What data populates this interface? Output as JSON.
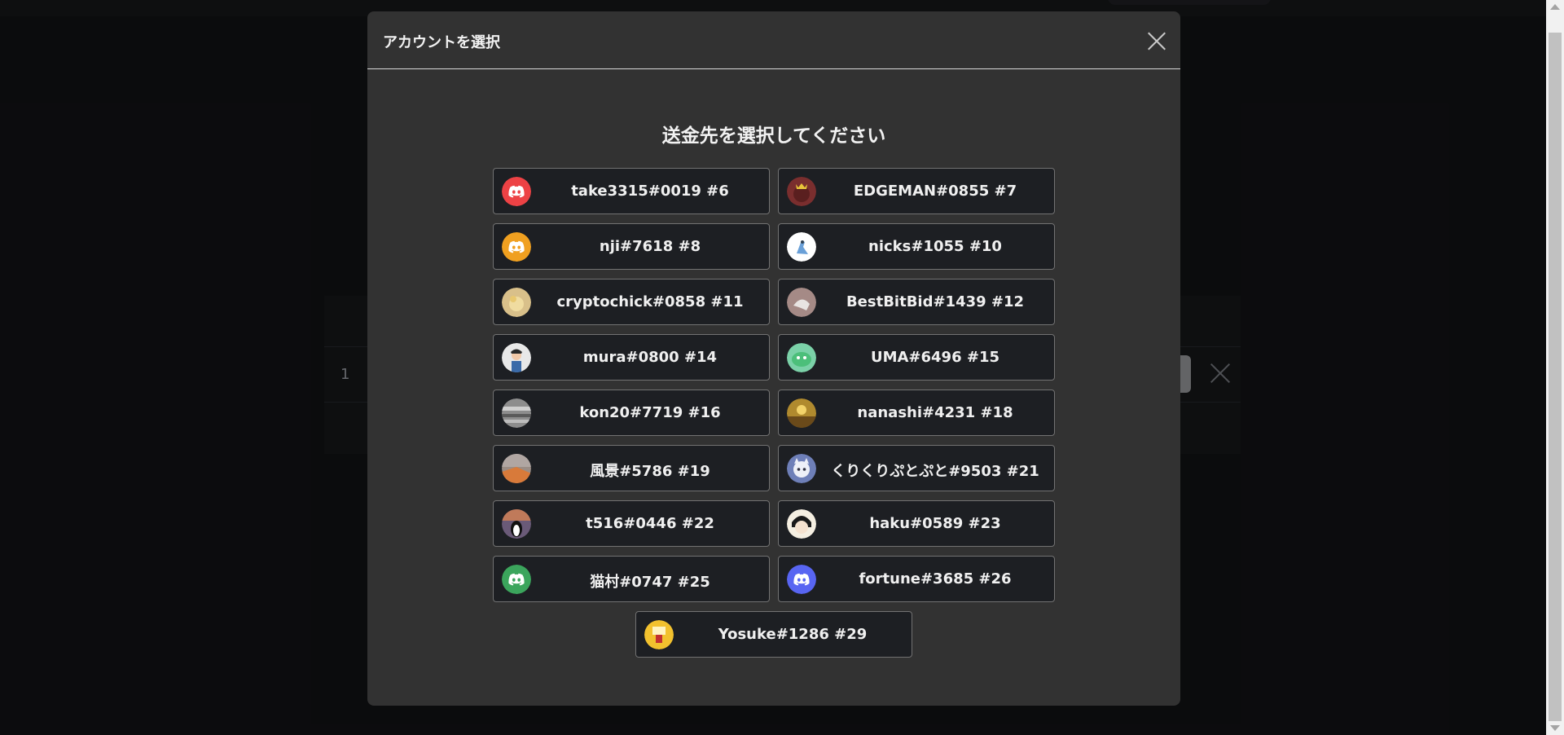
{
  "background": {
    "row_number": "1"
  },
  "modal": {
    "title": "アカウントを選択",
    "heading": "送金先を選択してください"
  },
  "accounts": [
    {
      "name": "take3315#0019 #6",
      "avatar": "discord-icon",
      "color": "#ed4245"
    },
    {
      "name": "EDGEMAN#0855 #7",
      "avatar": "crowned-creature-avatar",
      "color": "#7a2e2e"
    },
    {
      "name": "nji#7618 #8",
      "avatar": "discord-icon",
      "color": "#f0a020"
    },
    {
      "name": "nicks#1055 #10",
      "avatar": "bird-avatar",
      "color": "#ffffff"
    },
    {
      "name": "cryptochick#0858 #11",
      "avatar": "chick-photo-avatar",
      "color": "#d9c08a"
    },
    {
      "name": "BestBitBid#1439 #12",
      "avatar": "bird-photo-avatar",
      "color": "#a58a86"
    },
    {
      "name": "mura#0800 #14",
      "avatar": "person-avatar",
      "color": "#e8e8e8"
    },
    {
      "name": "UMA#6496 #15",
      "avatar": "green-creature-avatar",
      "color": "#7bd1a8"
    },
    {
      "name": "kon20#7719 #16",
      "avatar": "grayscale-photo-avatar",
      "color": "#8d8d8d"
    },
    {
      "name": "nanashi#4231 #18",
      "avatar": "sunset-photo-avatar",
      "color": "#b08a2e"
    },
    {
      "name": "風景#5786 #19",
      "avatar": "landscape-photo-avatar",
      "color": "#9a8d86"
    },
    {
      "name": "くりくりぷとぷと#9503 #21",
      "avatar": "cat-character-avatar",
      "color": "#6e7fb8"
    },
    {
      "name": "t516#0446 #22",
      "avatar": "penguin-photo-avatar",
      "color": "#6a5a78"
    },
    {
      "name": "haku#0589 #23",
      "avatar": "anime-character-avatar",
      "color": "#f5efe2"
    },
    {
      "name": "猫村#0747 #25",
      "avatar": "discord-icon",
      "color": "#3ba55c"
    },
    {
      "name": "fortune#3685 #26",
      "avatar": "discord-icon",
      "color": "#5865f2"
    },
    {
      "name": "Yosuke#1286 #29",
      "avatar": "yellow-character-avatar",
      "color": "#f2c12e"
    }
  ]
}
